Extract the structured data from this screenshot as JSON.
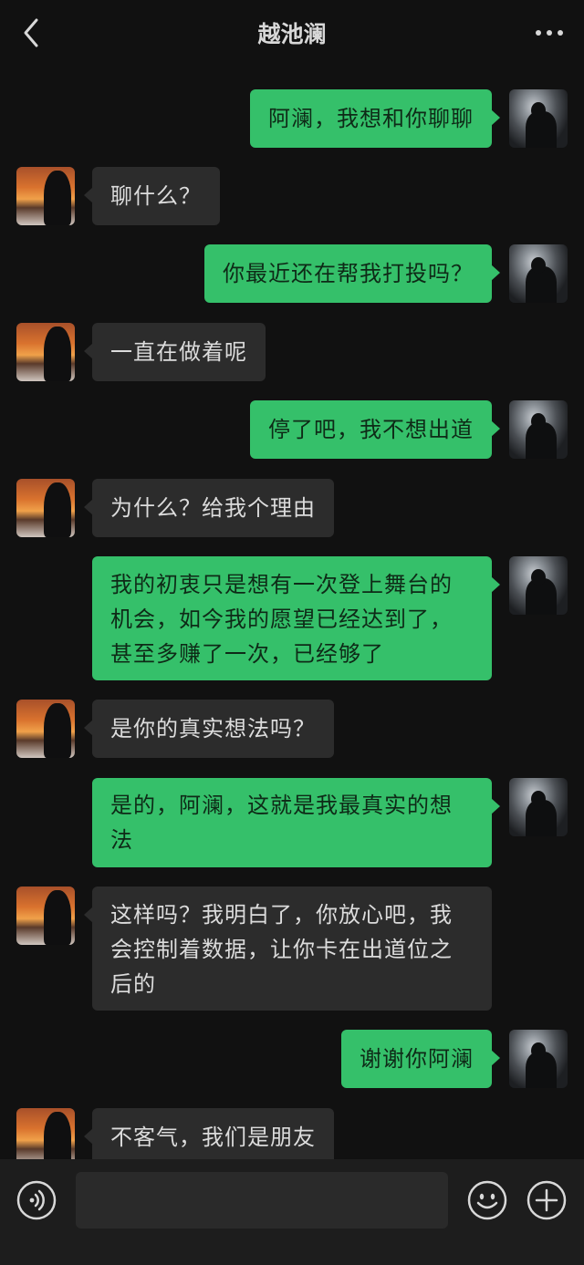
{
  "header": {
    "title": "越池澜",
    "back_icon": "chevron-left-icon",
    "more_icon": "more-horizontal-icon"
  },
  "messages": [
    {
      "side": "me",
      "text": "阿澜，我想和你聊聊"
    },
    {
      "side": "other",
      "text": "聊什么？"
    },
    {
      "side": "me",
      "text": "你最近还在帮我打投吗？"
    },
    {
      "side": "other",
      "text": "一直在做着呢"
    },
    {
      "side": "me",
      "text": "停了吧，我不想出道"
    },
    {
      "side": "other",
      "text": "为什么？给我个理由"
    },
    {
      "side": "me",
      "text": "我的初衷只是想有一次登上舞台的机会，如今我的愿望已经达到了，甚至多赚了一次，已经够了"
    },
    {
      "side": "other",
      "text": "是你的真实想法吗？"
    },
    {
      "side": "me",
      "text": "是的，阿澜，这就是我最真实的想法"
    },
    {
      "side": "other",
      "text": "这样吗？我明白了，你放心吧，我会控制着数据，让你卡在出道位之后的"
    },
    {
      "side": "me",
      "text": "谢谢你阿澜"
    },
    {
      "side": "other",
      "text": "不客气，我们是朋友"
    }
  ],
  "input_bar": {
    "voice_icon": "voice-icon",
    "input_value": "",
    "emoji_icon": "emoji-icon",
    "plus_icon": "plus-circle-icon"
  },
  "colors": {
    "background": "#111111",
    "my_bubble": "#35c06a",
    "other_bubble": "#2c2c2c",
    "input_bar": "#1d1d1d"
  }
}
